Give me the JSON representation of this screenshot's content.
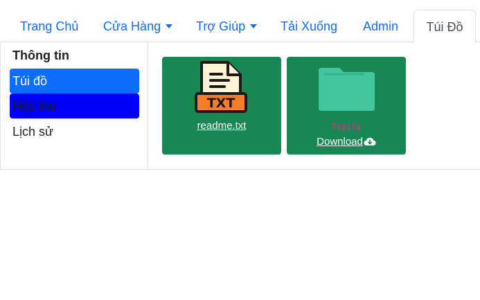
{
  "nav": {
    "items": [
      {
        "label": "Trang Chủ",
        "dropdown": false
      },
      {
        "label": "Cửa Hàng",
        "dropdown": true
      },
      {
        "label": "Trợ Giúp",
        "dropdown": true
      },
      {
        "label": "Tải Xuống",
        "dropdown": false
      },
      {
        "label": "Admin",
        "dropdown": false
      },
      {
        "label": "Túi Đồ",
        "dropdown": false,
        "active": true
      }
    ]
  },
  "sidebar": {
    "heading": "Thông tin",
    "items": [
      {
        "label": "Túi đồ",
        "active": true
      },
      {
        "label": "Hộp thư"
      },
      {
        "label": "Lịch sử"
      }
    ]
  },
  "cards": [
    {
      "file_link": "readme.txt",
      "icon": "txt-file-icon"
    },
    {
      "folder_label": "Trails",
      "download_label": "Download",
      "icon": "folder-icon",
      "action_icon": "cloud-download-icon"
    }
  ],
  "colors": {
    "link": "#0d6efd",
    "active_side": "#0d6efd",
    "inbox_side": "#0000ff",
    "card_bg": "#198754",
    "folder": "#43c59e",
    "txt_accent": "#f47c2a"
  }
}
